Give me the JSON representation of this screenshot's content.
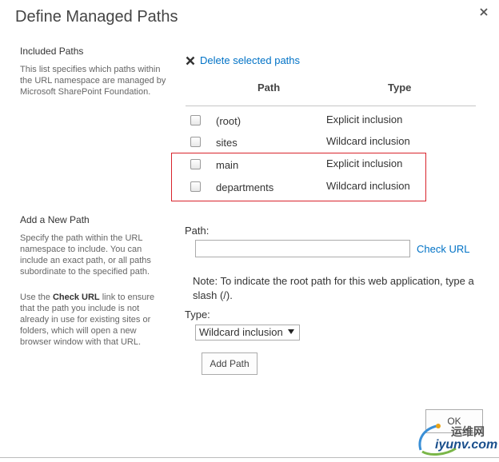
{
  "dialog": {
    "title": "Define Managed Paths"
  },
  "included_paths": {
    "heading": "Included Paths",
    "description": "This list specifies which paths within the URL namespace are managed by Microsoft SharePoint Foundation.",
    "delete_link": "Delete selected paths",
    "columns": {
      "path": "Path",
      "type": "Type"
    },
    "rows": [
      {
        "path": "(root)",
        "type": "Explicit inclusion",
        "checked": false
      },
      {
        "path": "sites",
        "type": "Wildcard inclusion",
        "checked": false
      },
      {
        "path": "main",
        "type": "Explicit inclusion",
        "checked": false
      },
      {
        "path": "departments",
        "type": "Wildcard inclusion",
        "checked": false
      }
    ]
  },
  "add_path": {
    "heading": "Add a New Path",
    "description1": "Specify the path within the URL namespace to include. You can include an exact path, or all paths subordinate to the specified path.",
    "description2_prefix": "Use the ",
    "description2_bold": "Check URL",
    "description2_suffix": " link to ensure that the path you include is not already in use for existing sites or folders, which will open a new browser window with that URL.",
    "path_label": "Path:",
    "path_value": "",
    "check_url": "Check URL",
    "note": "Note: To indicate the root path for this web application, type a slash (/).",
    "type_label": "Type:",
    "type_selected": "Wildcard inclusion",
    "add_button": "Add Path"
  },
  "footer": {
    "ok_button": "OK"
  },
  "watermark": {
    "line1": "运维网",
    "line2": "iyunv.com"
  },
  "colors": {
    "link": "#0072c6",
    "highlight": "#d9242c"
  }
}
